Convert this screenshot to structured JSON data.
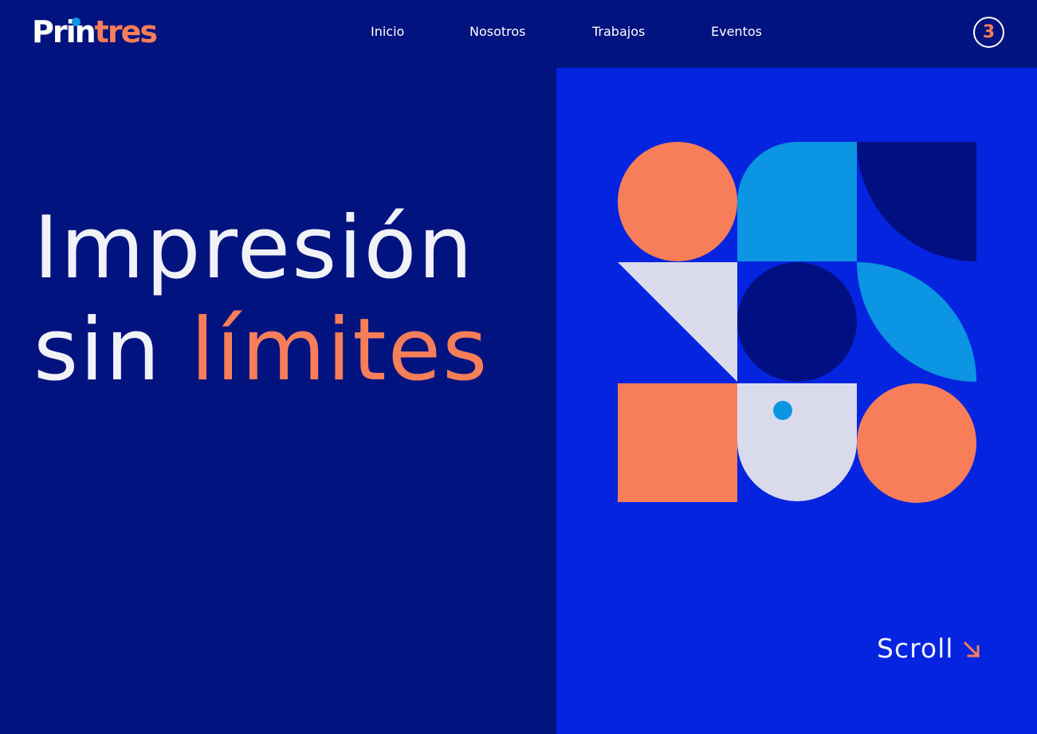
{
  "brand": {
    "logo_part_1": "Prin",
    "logo_part_2": "tres",
    "accent_color": "#f77e59",
    "dot_color": "#0b95e2"
  },
  "nav": {
    "items": [
      {
        "label": "Inicio"
      },
      {
        "label": "Nosotros"
      },
      {
        "label": "Trabajos"
      },
      {
        "label": "Eventos"
      }
    ]
  },
  "badge": {
    "value": "3"
  },
  "hero": {
    "line_1": "Impresión",
    "line_2_part_1": "sin",
    "line_2_part_2": "límites"
  },
  "scroll": {
    "label": "Scroll",
    "icon": "arrow-down-right-icon"
  },
  "colors": {
    "background": "#00137f",
    "panel": "#0424e0",
    "coral": "#f77e59",
    "sky": "#0b95e2",
    "navy": "#001082",
    "pale": "#d9dbed"
  }
}
